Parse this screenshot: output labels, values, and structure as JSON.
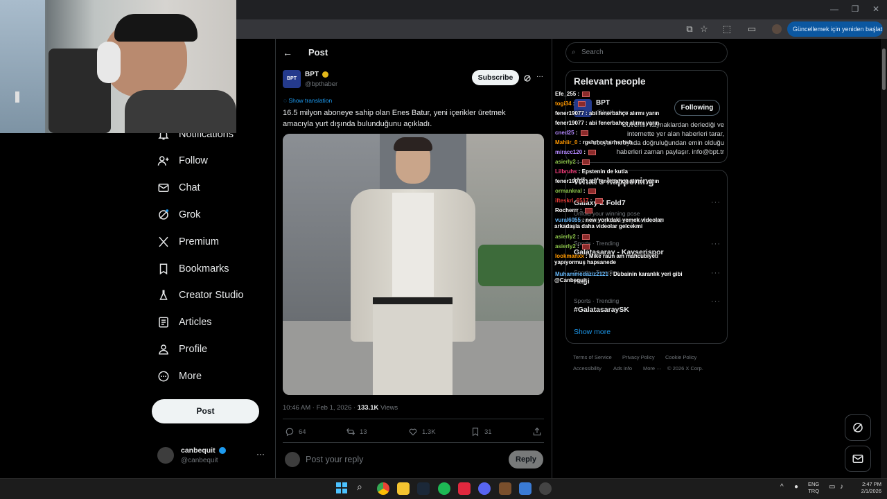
{
  "browser": {
    "update_button": "Güncellemek için yeniden başlat",
    "update_dots": "⋮",
    "window_controls": [
      "—",
      "❐",
      "✕"
    ]
  },
  "sidebar": {
    "items": [
      {
        "label": "Notifications",
        "icon": "bell-icon"
      },
      {
        "label": "Follow",
        "icon": "add-person-icon"
      },
      {
        "label": "Chat",
        "icon": "envelope-icon"
      },
      {
        "label": "Grok",
        "icon": "grok-icon"
      },
      {
        "label": "Premium",
        "icon": "x-logo-icon"
      },
      {
        "label": "Bookmarks",
        "icon": "bookmark-icon"
      },
      {
        "label": "Creator Studio",
        "icon": "flask-icon"
      },
      {
        "label": "Articles",
        "icon": "article-icon"
      },
      {
        "label": "Profile",
        "icon": "person-icon"
      },
      {
        "label": "More",
        "icon": "more-circle-icon"
      }
    ],
    "post_button": "Post",
    "account": {
      "name": "canbequit",
      "handle": "@canbequit",
      "more": "···"
    }
  },
  "post_header": {
    "back": "←",
    "title": "Post"
  },
  "post": {
    "author_name": "BPT",
    "author_handle": "@bpthaber",
    "avatar_text": "BPT",
    "subscribe": "Subscribe",
    "more": "···",
    "show_translation": "Show translation",
    "text_line1": "16.5 milyon aboneye sahip olan Enes Batur, yeni içerikler üretmek",
    "text_line2": "amacıyla yurt dışında bulunduğunu açıkladı.",
    "timestamp": "10:46 AM · Feb 1, 2026 · ",
    "views_count": "133.1K",
    "views_label": " Views",
    "stats": {
      "replies": "64",
      "reposts": "13",
      "likes": "1.3K",
      "bookmarks": "31"
    },
    "reply_placeholder": "Post your reply",
    "reply_button": "Reply"
  },
  "right": {
    "search_placeholder": "Search",
    "relevant_title": "Relevant people",
    "relevant_name": "BPT",
    "relevant_handle": "@bpthaber",
    "following": "Following",
    "bio_line1": "Güvenilir kaynaklardan derlediği ve",
    "bio_line2": "internette yer alan haberleri tarar,",
    "bio_line3": "sosyal medyada doğruluğundan emin olduğu",
    "bio_line4": "haberleri zaman paylaşır. info@bpt.tr",
    "happening_title": "What's happening",
    "trends": [
      {
        "meta": "",
        "name": "Galaxy Z Fold7",
        "sub": "Unfold your winning pose",
        "sub2": "Promoted by Samsung Mobile US"
      },
      {
        "meta": "Sports · Trending",
        "name": "Galatasaray - Kayserispor",
        "sub": "",
        "sub2": ""
      },
      {
        "meta": "Sports · Trending",
        "name": "Hagi",
        "sub": "",
        "sub2": ""
      },
      {
        "meta": "Sports · Trending",
        "name": "#GalatasaraySK",
        "sub": "",
        "sub2": ""
      }
    ],
    "show_more": "Show more",
    "footer": [
      "Terms of Service",
      "Privacy Policy",
      "Cookie Policy",
      "Accessibility",
      "Ads info",
      "More ···",
      "© 2026 X Corp."
    ]
  },
  "chat": [
    {
      "user": "Efe_255",
      "msg": "",
      "color": "#ffffff"
    },
    {
      "user": "togi34",
      "msg": "",
      "color": "#ff9800"
    },
    {
      "user": "fener19077",
      "msg": "abi fenerbahçe alırmı yarın",
      "color": "#ffffff"
    },
    {
      "user": "fener19077",
      "msg": "abi fenerbahçe alırmı yarın",
      "color": "#ffffff"
    },
    {
      "user": "cned25",
      "msg": "",
      "color": "#b388ff"
    },
    {
      "user": "Mahiir_0",
      "msg": "rgshrhrshsrhsrhsh",
      "color": "#ff9800"
    },
    {
      "user": "miracc120",
      "msg": "",
      "color": "#b388ff"
    },
    {
      "user": "asierly2",
      "msg": "",
      "color": "#8bc34a"
    },
    {
      "user": "Lilbruhs",
      "msg": "Epstenin de kutla",
      "color": "#ff4081"
    },
    {
      "user": "fener19077",
      "msg": "abi fenerbahçe alırmı yarın",
      "color": "#ffffff"
    },
    {
      "user": "ormankral",
      "msg": "",
      "color": "#8bc34a"
    },
    {
      "user": "ifteskrl_6517",
      "msg": "",
      "color": "#e53935"
    },
    {
      "user": "Rocherrr",
      "msg": "",
      "color": "#ffffff"
    },
    {
      "user": "vural6055",
      "msg": "new yorkdaki yemek videoları",
      "msg2": "arkadaşla daha videolar gelcekmi",
      "color": "#64b5f6"
    },
    {
      "user": "asierly2",
      "msg": "",
      "color": "#8bc34a"
    },
    {
      "user": "asierly2",
      "msg": "",
      "color": "#8bc34a"
    },
    {
      "user": "lookmanxx",
      "msg": "Mike raun am mahcubiyeti",
      "msg2": "yapıyormuş hapsanede",
      "color": "#ff9800"
    },
    {
      "user": "Muhammedaziz2121",
      "msg": "Dubainin karanlık yeri gibi",
      "msg2": "@Canbequit",
      "color": "#64b5f6"
    }
  ],
  "taskbar": {
    "lang1": "ENG",
    "lang2": "TRQ",
    "time": "2:47 PM",
    "date": "2/1/2026"
  }
}
